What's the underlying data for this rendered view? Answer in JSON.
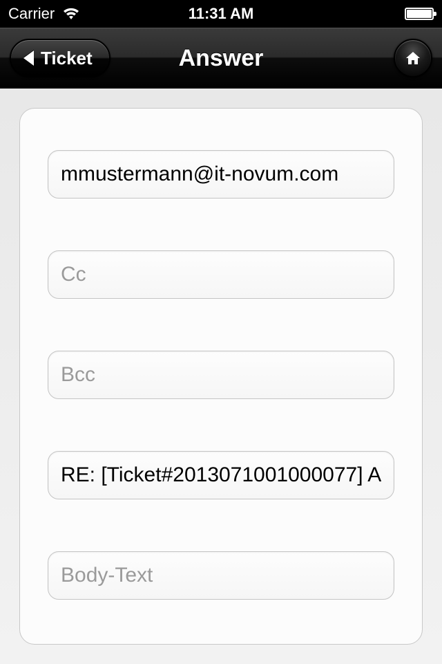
{
  "status": {
    "carrier": "Carrier",
    "time": "11:31 AM"
  },
  "nav": {
    "back_label": "Ticket",
    "title": "Answer"
  },
  "form": {
    "to_value": "mmustermann@it-novum.com",
    "cc_placeholder": "Cc",
    "cc_value": "",
    "bcc_placeholder": "Bcc",
    "bcc_value": "",
    "subject_value": "RE: [Ticket#2013071001000077] A",
    "body_placeholder": "Body-Text",
    "body_value": ""
  }
}
